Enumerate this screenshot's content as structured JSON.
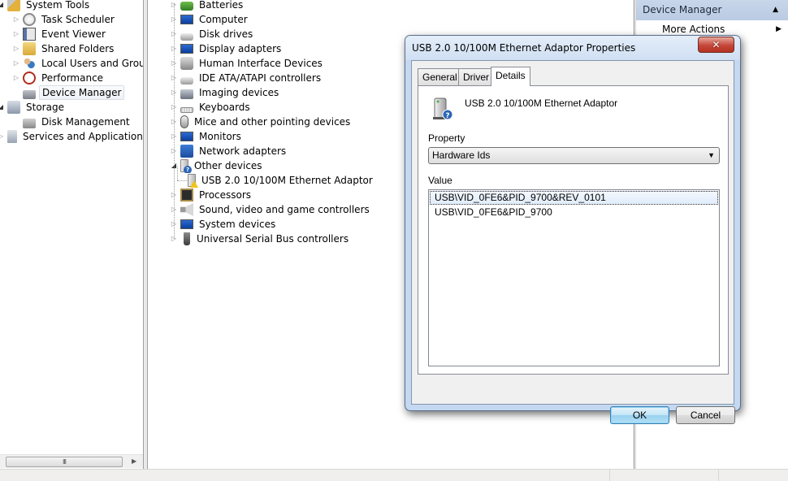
{
  "left_tree": {
    "items": [
      {
        "label": "System Tools",
        "icon": "tools-icon",
        "expander": "open",
        "level": 0
      },
      {
        "label": "Task Scheduler",
        "icon": "clock-icon",
        "expander": "closed",
        "level": 1
      },
      {
        "label": "Event Viewer",
        "icon": "event-viewer-icon",
        "expander": "closed",
        "level": 1
      },
      {
        "label": "Shared Folders",
        "icon": "shared-folder-icon",
        "expander": "closed",
        "level": 1
      },
      {
        "label": "Local Users and Groups",
        "icon": "users-icon",
        "expander": "closed",
        "level": 1
      },
      {
        "label": "Performance",
        "icon": "performance-icon",
        "expander": "closed",
        "level": 1
      },
      {
        "label": "Device Manager",
        "icon": "device-manager-icon",
        "expander": "none",
        "level": 1,
        "selected": true
      },
      {
        "label": "Storage",
        "icon": "storage-icon",
        "expander": "open",
        "level": 0
      },
      {
        "label": "Disk Management",
        "icon": "disk-management-icon",
        "expander": "none",
        "level": 1
      },
      {
        "label": "Services and Applications",
        "icon": "services-icon",
        "expander": "closed",
        "level": 0
      }
    ],
    "scrollbar_grip": "III"
  },
  "device_tree": {
    "items": [
      {
        "label": "Batteries",
        "icon": "battery-icon",
        "expander": "closed"
      },
      {
        "label": "Computer",
        "icon": "computer-icon",
        "expander": "closed"
      },
      {
        "label": "Disk drives",
        "icon": "disk-drive-icon",
        "expander": "closed"
      },
      {
        "label": "Display adapters",
        "icon": "display-adapter-icon",
        "expander": "closed"
      },
      {
        "label": "Human Interface Devices",
        "icon": "hid-icon",
        "expander": "closed"
      },
      {
        "label": "IDE ATA/ATAPI controllers",
        "icon": "ide-controller-icon",
        "expander": "closed"
      },
      {
        "label": "Imaging devices",
        "icon": "imaging-device-icon",
        "expander": "closed"
      },
      {
        "label": "Keyboards",
        "icon": "keyboard-icon",
        "expander": "closed"
      },
      {
        "label": "Mice and other pointing devices",
        "icon": "mouse-icon",
        "expander": "closed"
      },
      {
        "label": "Monitors",
        "icon": "monitor-icon",
        "expander": "closed"
      },
      {
        "label": "Network adapters",
        "icon": "network-adapter-icon",
        "expander": "closed"
      },
      {
        "label": "Other devices",
        "icon": "unknown-device-icon",
        "expander": "open"
      },
      {
        "label": "USB 2.0 10/100M Ethernet Adaptor",
        "icon": "warning-device-icon",
        "expander": "child"
      },
      {
        "label": "Processors",
        "icon": "processor-icon",
        "expander": "closed"
      },
      {
        "label": "Sound, video and game controllers",
        "icon": "sound-icon",
        "expander": "closed"
      },
      {
        "label": "System devices",
        "icon": "system-device-icon",
        "expander": "closed"
      },
      {
        "label": "Universal Serial Bus controllers",
        "icon": "usb-icon",
        "expander": "closed"
      }
    ]
  },
  "actions": {
    "header": "Device Manager",
    "more_actions": "More Actions"
  },
  "dialog": {
    "title": "USB 2.0 10/100M Ethernet Adaptor Properties",
    "close_glyph": "✕",
    "tabs": [
      {
        "label": "General",
        "active": false
      },
      {
        "label": "Driver",
        "active": false
      },
      {
        "label": "Details",
        "active": true
      }
    ],
    "device_name": "USB 2.0 10/100M Ethernet Adaptor",
    "property_label": "Property",
    "property_value": "Hardware Ids",
    "value_label": "Value",
    "values": [
      "USB\\VID_0FE6&PID_9700&REV_0101",
      "USB\\VID_0FE6&PID_9700"
    ],
    "ok_label": "OK",
    "cancel_label": "Cancel"
  }
}
